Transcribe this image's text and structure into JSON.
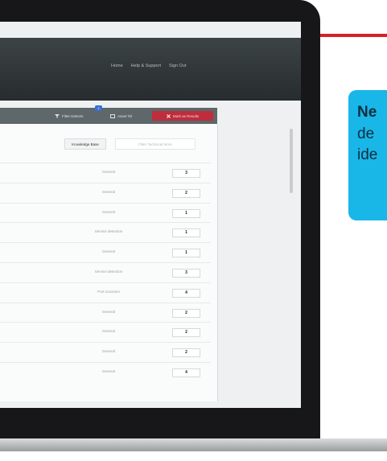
{
  "nav": {
    "items": [
      "Home",
      "Help & Support",
      "Sign Out"
    ]
  },
  "toolbar": {
    "filter_label": "Filter Detects",
    "filter_badge": "2",
    "add_label": "Asset Tel",
    "red_label": "Mark as Results"
  },
  "tabs": {
    "knowledge": "Knowledge Base",
    "tools": "Filter Technical More"
  },
  "rows": [
    {
      "category": "General",
      "count": "3"
    },
    {
      "category": "General",
      "count": "2"
    },
    {
      "category": "General",
      "count": "1"
    },
    {
      "category": "Service detection",
      "count": "1"
    },
    {
      "category": "General",
      "count": "1"
    },
    {
      "category": "Service detection",
      "count": "3"
    },
    {
      "category": "Port scanners",
      "count": "4"
    },
    {
      "category": "General",
      "count": "2"
    },
    {
      "category": "General",
      "count": "2"
    },
    {
      "category": "General",
      "count": "2"
    },
    {
      "category": "General",
      "count": "4"
    }
  ],
  "callout": {
    "line1": "Ne",
    "line2": "de",
    "line3": "ide"
  },
  "colors": {
    "accent_red": "#d81f26",
    "callout_blue": "#19b6e8",
    "toolbar_red": "#bf2d3d"
  }
}
